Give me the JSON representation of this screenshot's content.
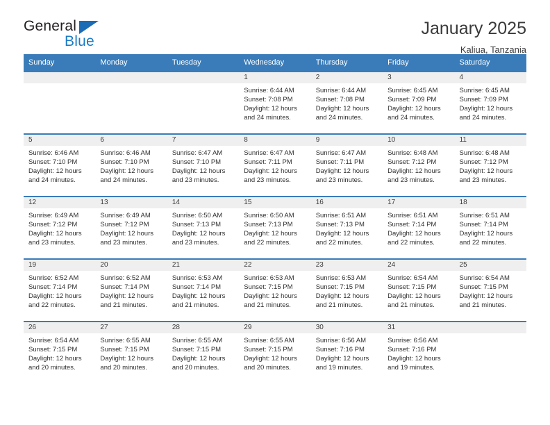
{
  "logo": {
    "word_one": "General",
    "word_two": "Blue",
    "triangle_color": "#1b6cb5",
    "blue_color": "#1b7bc4"
  },
  "header": {
    "title": "January 2025",
    "subtitle": "Kaliua, Tanzania"
  },
  "theme": {
    "header_band": "#3a7cb9",
    "day_strip": "#efefef",
    "text": "#2f2f2f"
  },
  "weekdays": [
    "Sunday",
    "Monday",
    "Tuesday",
    "Wednesday",
    "Thursday",
    "Friday",
    "Saturday"
  ],
  "weeks": [
    [
      {
        "day": "",
        "sunrise": "",
        "sunset": "",
        "daylight_1": "",
        "daylight_2": ""
      },
      {
        "day": "",
        "sunrise": "",
        "sunset": "",
        "daylight_1": "",
        "daylight_2": ""
      },
      {
        "day": "",
        "sunrise": "",
        "sunset": "",
        "daylight_1": "",
        "daylight_2": ""
      },
      {
        "day": "1",
        "sunrise": "Sunrise: 6:44 AM",
        "sunset": "Sunset: 7:08 PM",
        "daylight_1": "Daylight: 12 hours",
        "daylight_2": "and 24 minutes."
      },
      {
        "day": "2",
        "sunrise": "Sunrise: 6:44 AM",
        "sunset": "Sunset: 7:08 PM",
        "daylight_1": "Daylight: 12 hours",
        "daylight_2": "and 24 minutes."
      },
      {
        "day": "3",
        "sunrise": "Sunrise: 6:45 AM",
        "sunset": "Sunset: 7:09 PM",
        "daylight_1": "Daylight: 12 hours",
        "daylight_2": "and 24 minutes."
      },
      {
        "day": "4",
        "sunrise": "Sunrise: 6:45 AM",
        "sunset": "Sunset: 7:09 PM",
        "daylight_1": "Daylight: 12 hours",
        "daylight_2": "and 24 minutes."
      }
    ],
    [
      {
        "day": "5",
        "sunrise": "Sunrise: 6:46 AM",
        "sunset": "Sunset: 7:10 PM",
        "daylight_1": "Daylight: 12 hours",
        "daylight_2": "and 24 minutes."
      },
      {
        "day": "6",
        "sunrise": "Sunrise: 6:46 AM",
        "sunset": "Sunset: 7:10 PM",
        "daylight_1": "Daylight: 12 hours",
        "daylight_2": "and 24 minutes."
      },
      {
        "day": "7",
        "sunrise": "Sunrise: 6:47 AM",
        "sunset": "Sunset: 7:10 PM",
        "daylight_1": "Daylight: 12 hours",
        "daylight_2": "and 23 minutes."
      },
      {
        "day": "8",
        "sunrise": "Sunrise: 6:47 AM",
        "sunset": "Sunset: 7:11 PM",
        "daylight_1": "Daylight: 12 hours",
        "daylight_2": "and 23 minutes."
      },
      {
        "day": "9",
        "sunrise": "Sunrise: 6:47 AM",
        "sunset": "Sunset: 7:11 PM",
        "daylight_1": "Daylight: 12 hours",
        "daylight_2": "and 23 minutes."
      },
      {
        "day": "10",
        "sunrise": "Sunrise: 6:48 AM",
        "sunset": "Sunset: 7:12 PM",
        "daylight_1": "Daylight: 12 hours",
        "daylight_2": "and 23 minutes."
      },
      {
        "day": "11",
        "sunrise": "Sunrise: 6:48 AM",
        "sunset": "Sunset: 7:12 PM",
        "daylight_1": "Daylight: 12 hours",
        "daylight_2": "and 23 minutes."
      }
    ],
    [
      {
        "day": "12",
        "sunrise": "Sunrise: 6:49 AM",
        "sunset": "Sunset: 7:12 PM",
        "daylight_1": "Daylight: 12 hours",
        "daylight_2": "and 23 minutes."
      },
      {
        "day": "13",
        "sunrise": "Sunrise: 6:49 AM",
        "sunset": "Sunset: 7:12 PM",
        "daylight_1": "Daylight: 12 hours",
        "daylight_2": "and 23 minutes."
      },
      {
        "day": "14",
        "sunrise": "Sunrise: 6:50 AM",
        "sunset": "Sunset: 7:13 PM",
        "daylight_1": "Daylight: 12 hours",
        "daylight_2": "and 23 minutes."
      },
      {
        "day": "15",
        "sunrise": "Sunrise: 6:50 AM",
        "sunset": "Sunset: 7:13 PM",
        "daylight_1": "Daylight: 12 hours",
        "daylight_2": "and 22 minutes."
      },
      {
        "day": "16",
        "sunrise": "Sunrise: 6:51 AM",
        "sunset": "Sunset: 7:13 PM",
        "daylight_1": "Daylight: 12 hours",
        "daylight_2": "and 22 minutes."
      },
      {
        "day": "17",
        "sunrise": "Sunrise: 6:51 AM",
        "sunset": "Sunset: 7:14 PM",
        "daylight_1": "Daylight: 12 hours",
        "daylight_2": "and 22 minutes."
      },
      {
        "day": "18",
        "sunrise": "Sunrise: 6:51 AM",
        "sunset": "Sunset: 7:14 PM",
        "daylight_1": "Daylight: 12 hours",
        "daylight_2": "and 22 minutes."
      }
    ],
    [
      {
        "day": "19",
        "sunrise": "Sunrise: 6:52 AM",
        "sunset": "Sunset: 7:14 PM",
        "daylight_1": "Daylight: 12 hours",
        "daylight_2": "and 22 minutes."
      },
      {
        "day": "20",
        "sunrise": "Sunrise: 6:52 AM",
        "sunset": "Sunset: 7:14 PM",
        "daylight_1": "Daylight: 12 hours",
        "daylight_2": "and 21 minutes."
      },
      {
        "day": "21",
        "sunrise": "Sunrise: 6:53 AM",
        "sunset": "Sunset: 7:14 PM",
        "daylight_1": "Daylight: 12 hours",
        "daylight_2": "and 21 minutes."
      },
      {
        "day": "22",
        "sunrise": "Sunrise: 6:53 AM",
        "sunset": "Sunset: 7:15 PM",
        "daylight_1": "Daylight: 12 hours",
        "daylight_2": "and 21 minutes."
      },
      {
        "day": "23",
        "sunrise": "Sunrise: 6:53 AM",
        "sunset": "Sunset: 7:15 PM",
        "daylight_1": "Daylight: 12 hours",
        "daylight_2": "and 21 minutes."
      },
      {
        "day": "24",
        "sunrise": "Sunrise: 6:54 AM",
        "sunset": "Sunset: 7:15 PM",
        "daylight_1": "Daylight: 12 hours",
        "daylight_2": "and 21 minutes."
      },
      {
        "day": "25",
        "sunrise": "Sunrise: 6:54 AM",
        "sunset": "Sunset: 7:15 PM",
        "daylight_1": "Daylight: 12 hours",
        "daylight_2": "and 21 minutes."
      }
    ],
    [
      {
        "day": "26",
        "sunrise": "Sunrise: 6:54 AM",
        "sunset": "Sunset: 7:15 PM",
        "daylight_1": "Daylight: 12 hours",
        "daylight_2": "and 20 minutes."
      },
      {
        "day": "27",
        "sunrise": "Sunrise: 6:55 AM",
        "sunset": "Sunset: 7:15 PM",
        "daylight_1": "Daylight: 12 hours",
        "daylight_2": "and 20 minutes."
      },
      {
        "day": "28",
        "sunrise": "Sunrise: 6:55 AM",
        "sunset": "Sunset: 7:15 PM",
        "daylight_1": "Daylight: 12 hours",
        "daylight_2": "and 20 minutes."
      },
      {
        "day": "29",
        "sunrise": "Sunrise: 6:55 AM",
        "sunset": "Sunset: 7:15 PM",
        "daylight_1": "Daylight: 12 hours",
        "daylight_2": "and 20 minutes."
      },
      {
        "day": "30",
        "sunrise": "Sunrise: 6:56 AM",
        "sunset": "Sunset: 7:16 PM",
        "daylight_1": "Daylight: 12 hours",
        "daylight_2": "and 19 minutes."
      },
      {
        "day": "31",
        "sunrise": "Sunrise: 6:56 AM",
        "sunset": "Sunset: 7:16 PM",
        "daylight_1": "Daylight: 12 hours",
        "daylight_2": "and 19 minutes."
      },
      {
        "day": "",
        "sunrise": "",
        "sunset": "",
        "daylight_1": "",
        "daylight_2": ""
      }
    ]
  ]
}
